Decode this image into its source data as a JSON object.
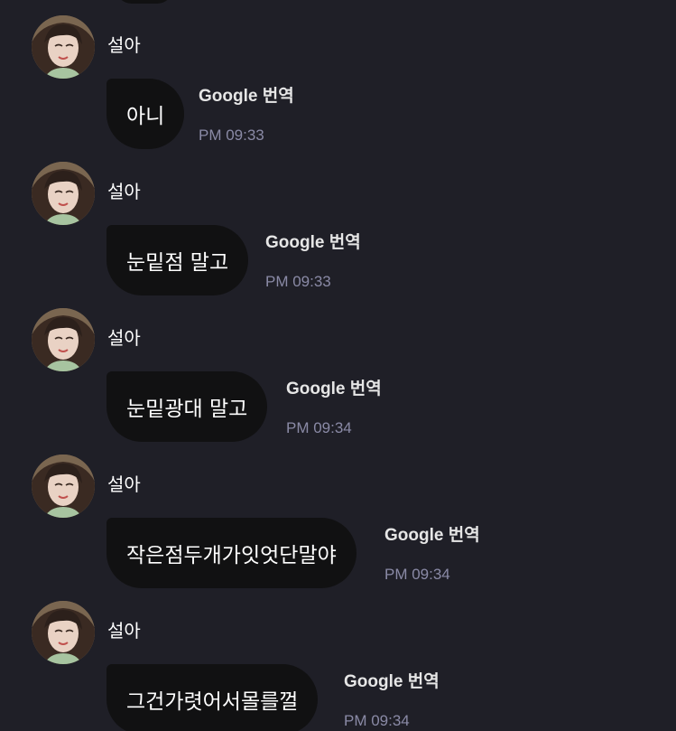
{
  "messages": [
    {
      "sender": "설아",
      "text": "아니",
      "translate_label": "Google 번역",
      "time": "PM 09:33"
    },
    {
      "sender": "설아",
      "text": "눈밑점 말고",
      "translate_label": "Google 번역",
      "time": "PM 09:33"
    },
    {
      "sender": "설아",
      "text": "눈밑광대 말고",
      "translate_label": "Google 번역",
      "time": "PM 09:34"
    },
    {
      "sender": "설아",
      "text": "작은점두개가잇엇단말야",
      "translate_label": "Google 번역",
      "time": "PM 09:34"
    },
    {
      "sender": "설아",
      "text": "그건가렷어서몰를껄",
      "translate_label": "Google 번역",
      "time": "PM 09:34"
    }
  ],
  "colors": {
    "background": "#1f1f27",
    "bubble": "#111112",
    "time_text": "#8a8aa6",
    "translate_text": "#e6e6e6"
  },
  "icons": {
    "avatar": "profile-photo-avatar-icon"
  }
}
